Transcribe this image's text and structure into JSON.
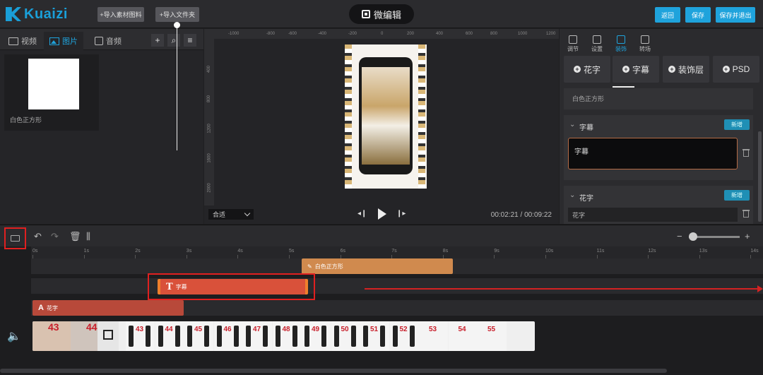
{
  "app": {
    "logo_text": "Kuaizi",
    "title": "微编辑",
    "brand_color": "#1fa3dc"
  },
  "topbar": {
    "import_material": "+导入素材图料",
    "import_folder": "+导入文件夹",
    "back": "返回",
    "save": "保存",
    "save_exit": "保存并退出"
  },
  "left_panel": {
    "tabs": [
      {
        "label": "视频",
        "icon": "film-icon"
      },
      {
        "label": "图片",
        "icon": "image-icon",
        "active": true
      },
      {
        "label": "音频",
        "icon": "music-icon"
      }
    ],
    "actions": [
      "plus-icon",
      "search-icon",
      "list-icon"
    ],
    "items": [
      {
        "label": "白色正方形"
      }
    ]
  },
  "preview": {
    "ruler_h": [
      "-1000",
      "-800",
      "-600",
      "-400",
      "-200",
      "0",
      "200",
      "400",
      "600",
      "800",
      "1000",
      "1200",
      "1400",
      "1600",
      "1800",
      "2000",
      "2200",
      "2400"
    ],
    "ruler_v": [
      "400",
      "800",
      "1200",
      "1600",
      "2000"
    ],
    "fit_option": "合适",
    "current_time": "00:02:21",
    "total_time": "00:09:22"
  },
  "right_panel": {
    "tabs": [
      {
        "label": "调节",
        "icon": "crop-icon"
      },
      {
        "label": "设置",
        "icon": "sliders-icon"
      },
      {
        "label": "装饰",
        "icon": "brush-icon",
        "active": true
      },
      {
        "label": "转场",
        "icon": "transition-icon"
      }
    ],
    "add_buttons": [
      "花字",
      "字幕",
      "装饰层",
      "PSD"
    ],
    "sections": [
      {
        "label": "白色正方形"
      },
      {
        "head": "字幕",
        "new": "新增",
        "text": "字幕"
      },
      {
        "head": "花字",
        "new": "新增",
        "text": "花字"
      }
    ]
  },
  "timeline": {
    "ticks": [
      "0s",
      "1s",
      "2s",
      "3s",
      "4s",
      "5s",
      "6s",
      "7s",
      "8s",
      "9s",
      "10s",
      "11s",
      "12s",
      "13s",
      "14s"
    ],
    "clips": {
      "decor": "白色正方形",
      "subtitle": "字幕",
      "fancy": "花字"
    },
    "frame_numbers": [
      "43",
      "44",
      "43",
      "44",
      "45",
      "46",
      "47",
      "48",
      "49",
      "50",
      "51",
      "52",
      "53",
      "54",
      "55"
    ],
    "colors": {
      "decor": "#d08a4e",
      "subtitle": "#d9513a",
      "fancy": "#b8493a",
      "highlight": "#e02020"
    }
  }
}
